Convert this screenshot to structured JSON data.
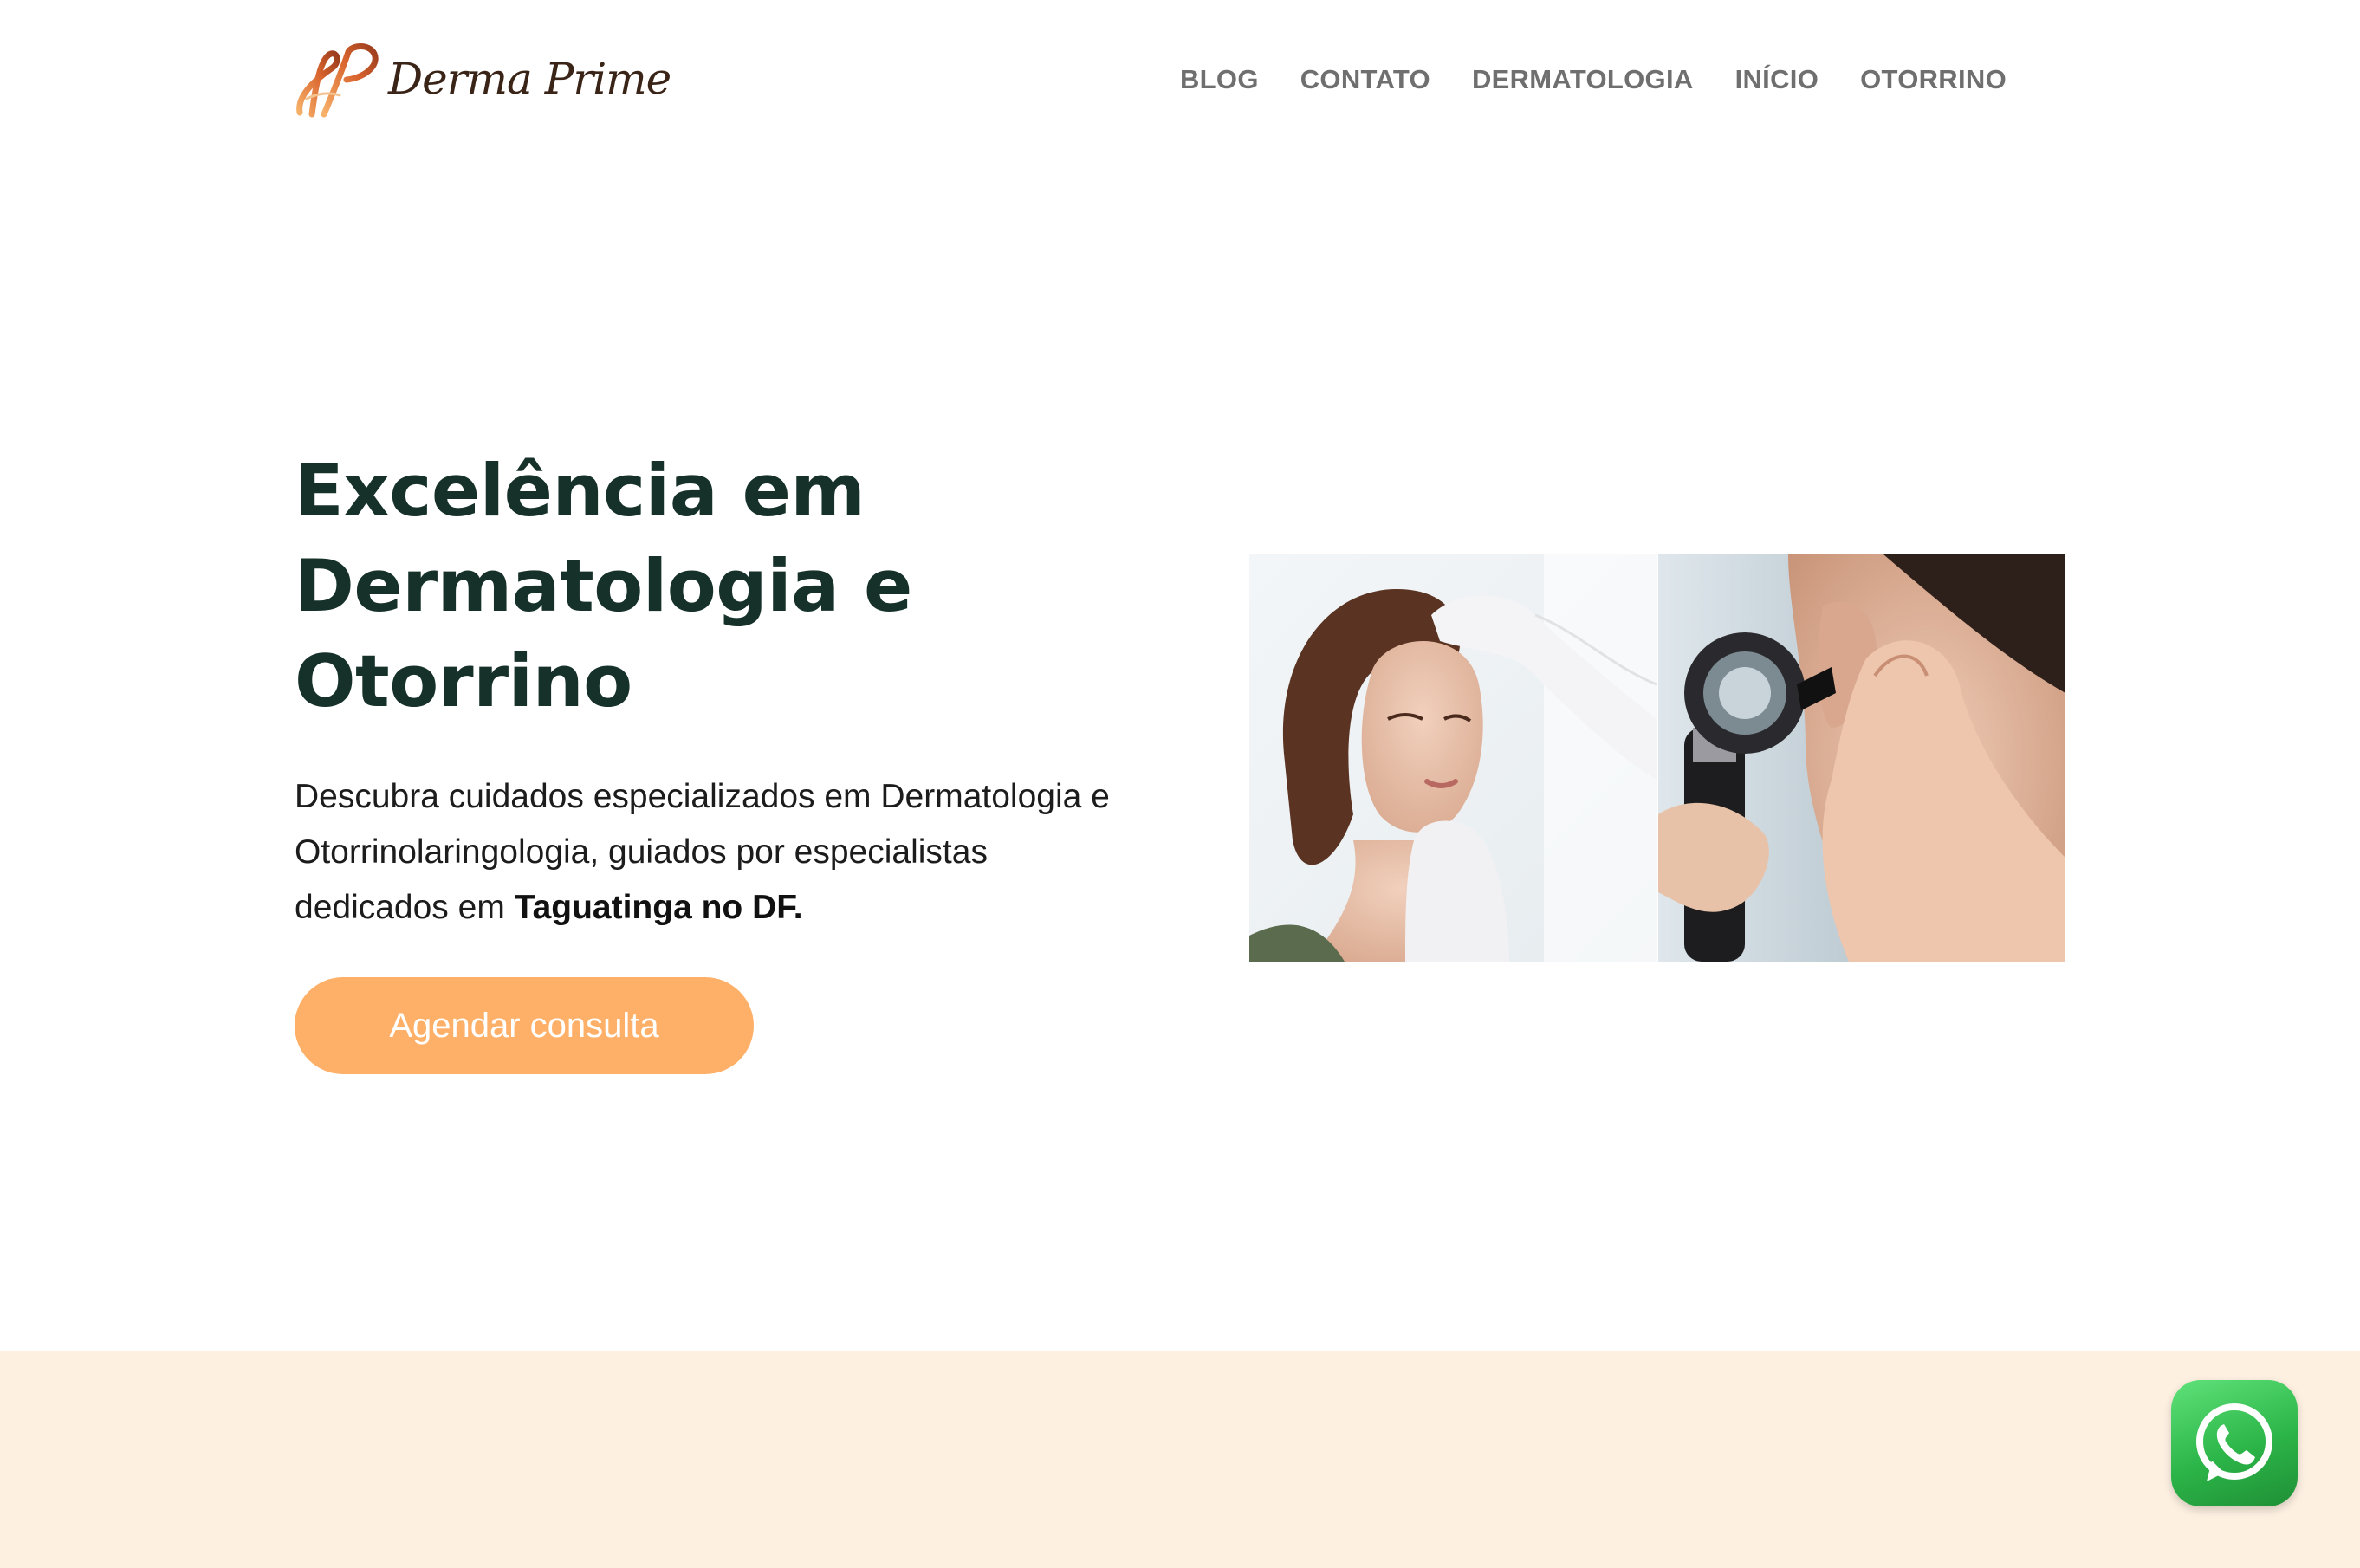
{
  "header": {
    "brand": "Derma Prime",
    "nav": [
      {
        "label": "BLOG"
      },
      {
        "label": "CONTATO"
      },
      {
        "label": "DERMATOLOGIA"
      },
      {
        "label": "INÍCIO"
      },
      {
        "label": "OTORRINO"
      }
    ]
  },
  "hero": {
    "title_lines": [
      "Excelência em",
      "Dermatologia e",
      "Otorrino"
    ],
    "description": "Descubra cuidados especializados em Dermatologia e Otorrinolaringologia, guiados por especialistas dedicados em ",
    "description_bold": "Taguatinga no DF.",
    "cta_label": "Agendar consulta",
    "images": [
      {
        "name": "dermatology-exam-photo"
      },
      {
        "name": "otoscope-ear-exam-photo"
      }
    ]
  },
  "floating": {
    "whatsapp_icon": "whatsapp-icon"
  },
  "colors": {
    "title": "#16312a",
    "nav": "#6f6f6f",
    "cta_bg": "#feb068",
    "band_bg": "#fdf0e1",
    "whatsapp": "#2cb548"
  }
}
